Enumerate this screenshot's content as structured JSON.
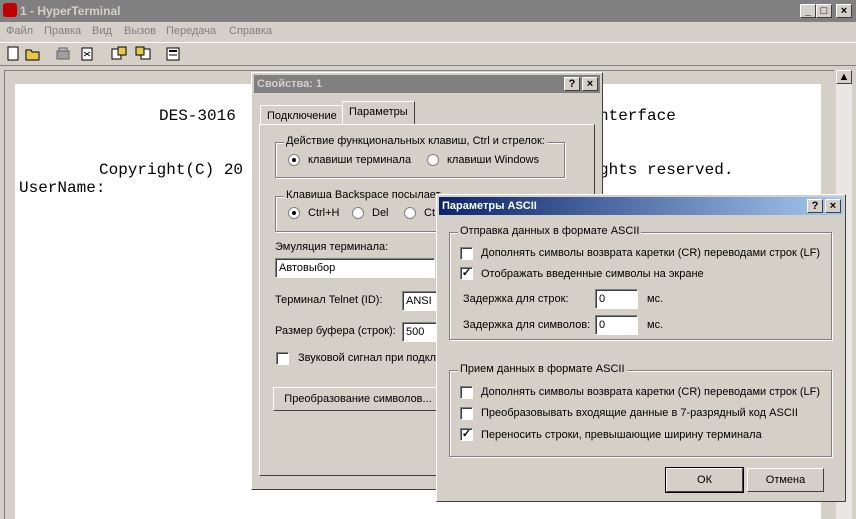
{
  "main": {
    "title": "1 - HyperTerminal",
    "menu": [
      "Файл",
      "Правка",
      "Вид",
      "Вызов",
      "Передача",
      "Справка"
    ],
    "terminal_lines": [
      "DES-3016 ",
      "nterface",
      "Copyright(C) 20",
      "ghts reserved.",
      "UserName:"
    ]
  },
  "props": {
    "title": "Свойства: 1",
    "tabs": [
      "Подключение",
      "Параметры"
    ],
    "keys_group": "Действие функциональных клавиш, Ctrl и стрелок:",
    "keys_terminal": "клавиши терминала",
    "keys_windows": "клавиши Windows",
    "backspace_group": "Клавиша  Backspace посылает",
    "bs_ctrlh": "Ctrl+H",
    "bs_del": "Del",
    "bs_ctrl_partial": "Ct",
    "emulation_label": "Эмуляция терминала:",
    "emulation_value": "Автовыбор",
    "telnet_label": "Терминал Telnet (ID):",
    "telnet_value": "ANSI",
    "buffer_label": "Размер буфера (строк):",
    "buffer_value": "500",
    "beep_label": "Звуковой сигнал при подкл",
    "convert_button": "Преобразование символов..."
  },
  "ascii": {
    "title": "Параметры ASCII",
    "send_group": "Отправка данных в формате ASCII",
    "send_append_lf": "Дополнять символы возврата каретки (CR) переводами строк (LF)",
    "send_echo": "Отображать введенные символы на экране",
    "line_delay_label": "Задержка для строк:",
    "line_delay_value": "0",
    "char_delay_label": "Задержка для символов:",
    "char_delay_value": "0",
    "unit": "мс.",
    "recv_group": "Прием данных в формате ASCII",
    "recv_append_lf": "Дополнять символы возврата каретки (CR) переводами строк (LF)",
    "recv_7bit": "Преобразовывать входящие данные в 7-разрядный код ASCII",
    "recv_wrap": "Переносить строки, превышающие ширину терминала",
    "ok": "ОК",
    "cancel": "Отмена"
  },
  "icons": {
    "app": "hyperterminal-icon",
    "toolbar": [
      "new-icon",
      "open-icon",
      "phone-icon",
      "disconnect-icon",
      "send-icon",
      "receive-icon",
      "properties-icon"
    ]
  }
}
